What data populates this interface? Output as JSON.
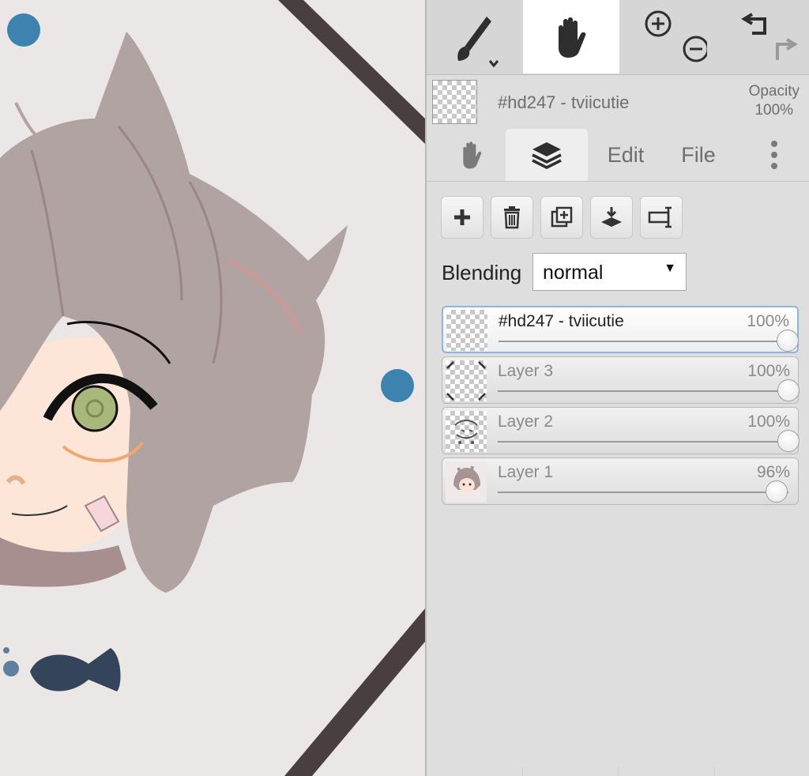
{
  "toolbar": {
    "tools": [
      {
        "name": "brush-tool",
        "icon": "paintbrush-icon",
        "active": false
      },
      {
        "name": "hand-tool",
        "icon": "hand-icon",
        "active": true
      },
      {
        "name": "zoom-tool",
        "icon": "zoom-in-out-icon",
        "active": false
      },
      {
        "name": "undo-redo",
        "icon": "undo-redo-icon",
        "active": false
      }
    ]
  },
  "layer_info": {
    "name": "#hd247 - tviicutie",
    "opacity_label": "Opacity",
    "opacity_value": "100%"
  },
  "tabs": [
    {
      "label": "",
      "icon": "hand-icon",
      "active": false
    },
    {
      "label": "",
      "icon": "layers-icon",
      "active": true
    },
    {
      "label": "Edit",
      "active": false
    },
    {
      "label": "File",
      "active": false
    },
    {
      "label": "",
      "icon": "more-vertical-icon",
      "active": false
    }
  ],
  "layer_actions": [
    {
      "icon": "add-layer-icon"
    },
    {
      "icon": "delete-layer-icon"
    },
    {
      "icon": "duplicate-layer-icon"
    },
    {
      "icon": "merge-down-icon"
    },
    {
      "icon": "rename-layer-icon"
    }
  ],
  "blending": {
    "label": "Blending",
    "value": "normal"
  },
  "layers": [
    {
      "name": "#hd247 - tviicutie",
      "opacity": "100%",
      "opacity_fraction": 1.0,
      "selected": true
    },
    {
      "name": "Layer 3",
      "opacity": "100%",
      "opacity_fraction": 1.0,
      "selected": false
    },
    {
      "name": "Layer 2",
      "opacity": "100%",
      "opacity_fraction": 1.0,
      "selected": false
    },
    {
      "name": "Layer 1",
      "opacity": "96%",
      "opacity_fraction": 0.96,
      "selected": false
    }
  ],
  "colors": {
    "accent_selected_border": "#8fb4e3",
    "canvas_background": "#ebe7e7",
    "panel_background": "#dedede"
  }
}
